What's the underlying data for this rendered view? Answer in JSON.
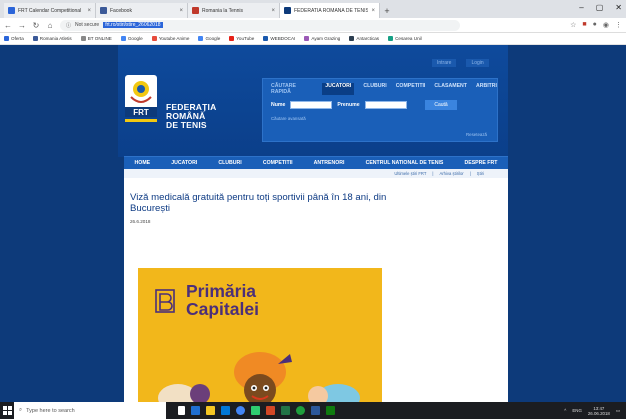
{
  "browser": {
    "tabs": [
      {
        "label": "FRT Calendar Competitional",
        "active": false,
        "color": "#2b65d9"
      },
      {
        "label": "Facebook",
        "active": false,
        "color": "#3b5998"
      },
      {
        "label": "Romania la Tennis",
        "active": false,
        "color": "#c0392b"
      },
      {
        "label": "FEDERATIA ROMANA DE TENIS",
        "active": true,
        "color": "#0d3a7a"
      }
    ],
    "url_prefix": "Not secure",
    "url": "frt.ro/stiri/stire_26062018",
    "bookmarks": [
      "Oferta",
      "Romania Atletis",
      "BT ONLINE",
      "Google",
      "Youtube Anime",
      "Google",
      "YouTube",
      "WEBDOCAI",
      "Ayam Grazing",
      "Antarcticas",
      "Cesarea Unil"
    ]
  },
  "site": {
    "brand_lines": [
      "FEDERAȚIA",
      "ROMÂNĂ",
      "DE TENIS"
    ],
    "logo_text": "FRT",
    "toplinks": [
      "Intrare",
      "Login"
    ],
    "search": {
      "title": "CĂUTARE RAPIDĂ",
      "tabs": [
        "JUCATORI",
        "CLUBURI",
        "COMPETITII",
        "CLASAMENT",
        "ARBITRI"
      ],
      "label_name": "Nume",
      "label_surname": "Prenume",
      "button": "Caută",
      "advanced_link": "Căutare avansată",
      "reset_link": "Resetează"
    },
    "nav": [
      "HOME",
      "JUCATORI",
      "CLUBURI",
      "COMPETITII",
      "ANTRENORI",
      "CENTRUL NATIONAL DE TENIS",
      "DESPRE FRT"
    ],
    "subnav": [
      "Ultimele știri FRT",
      "Arhiva știrilor",
      "Știri"
    ],
    "article": {
      "title": "Viză medicală gratuită pentru toți sportivii până în 18 ani, din București",
      "date": "26.6.2018"
    },
    "poster_text_line1": "Primăria",
    "poster_text_line2": "Capitalei"
  },
  "taskbar": {
    "search_placeholder": "Type here to search",
    "time": "13:47",
    "date": "26.06.2018",
    "lang": "ENG"
  },
  "colors": {
    "page_bg": "#0d3a7a",
    "nav_bg": "#1a5fb8",
    "poster_bg": "#f2b71b",
    "poster_text": "#4b2f79"
  }
}
